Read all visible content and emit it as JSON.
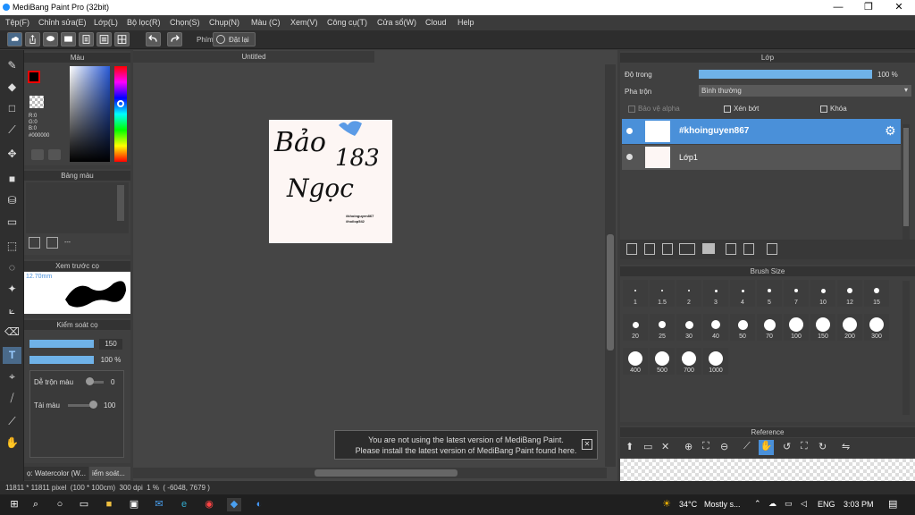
{
  "window": {
    "title": "MediBang Paint Pro (32bit)",
    "controls": {
      "minimize": "—",
      "maximize": "❐",
      "close": "✕"
    }
  },
  "menu": [
    "Tệp(F)",
    "Chỉnh sửa(E)",
    "Lớp(L)",
    "Bộ lọc(R)",
    "Chọn(S)",
    "Chụp(N)",
    "Màu (C)",
    "Xem(V)",
    "Công cụ(T)",
    "Cửa sổ(W)",
    "Cloud",
    "Help"
  ],
  "toolbar": {
    "shortcut_label": "Phím",
    "reset_label": "Đặt lại"
  },
  "color_panel": {
    "title": "Màu",
    "r": "R:0",
    "g": "G:0",
    "b": "B:0",
    "hex": "#000000"
  },
  "palette_panel": {
    "title": "Bảng màu",
    "footer": "---"
  },
  "brush_preview_panel": {
    "title": "Xem trước cọ",
    "size": "12.70mm"
  },
  "brush_control_panel": {
    "title": "Kiểm soát cọ",
    "size_value": "150",
    "opacity_value": "100 %",
    "blend_label": "Dễ trộn màu",
    "blend_value": "0",
    "reload_label": "Tải màu",
    "reload_value": "100"
  },
  "bottom_tabs": {
    "tab1": "ọ: Watercolor (W...",
    "tab2": "iểm soát..."
  },
  "document": {
    "tab_title": "Untitled"
  },
  "canvas_art": {
    "line1": "Bảo",
    "number": "183",
    "line2": "Ngọc",
    "tag1": "#khoinguyen867",
    "tag2": "#hoilop542"
  },
  "notice": {
    "line1": "You are not using the latest version of MediBang Paint.",
    "line2": "Please install the latest version of MediBang Paint found here.",
    "close": "✕"
  },
  "layer_panel": {
    "title": "Lớp",
    "opacity_label": "Độ trong",
    "opacity_value": "100 %",
    "opacity_level": 1.0,
    "blend_label": "Pha trộn",
    "blend_value": "Bình thường",
    "protect_alpha": "Bảo vệ alpha",
    "clipping": "Xén bớt",
    "lock": "Khóa",
    "layers": [
      {
        "name": "#khoinguyen867",
        "selected": true
      },
      {
        "name": "Lớp1",
        "selected": false
      }
    ]
  },
  "brush_size_panel": {
    "title": "Brush Size",
    "sizes": [
      "1",
      "1.5",
      "2",
      "3",
      "4",
      "5",
      "7",
      "10",
      "12",
      "15",
      "20",
      "25",
      "30",
      "40",
      "50",
      "70",
      "100",
      "150",
      "200",
      "300",
      "400",
      "500",
      "700",
      "1000"
    ]
  },
  "reference_panel": {
    "title": "Reference"
  },
  "statusbar": {
    "text": "11811 * 11811 pixel  (100 * 100cm)  300 dpi  1 %  ( -6048, 7679 )"
  },
  "taskbar": {
    "weather_temp": "34°C",
    "weather_desc": "Mostly s...",
    "lang": "ENG",
    "time": "3:03 PM"
  },
  "colors": {
    "accent": "#4a90d9",
    "selected_layer": "#4a90d9",
    "panel_bg": "#404040",
    "canvas_bg": "#fdf6f4"
  }
}
